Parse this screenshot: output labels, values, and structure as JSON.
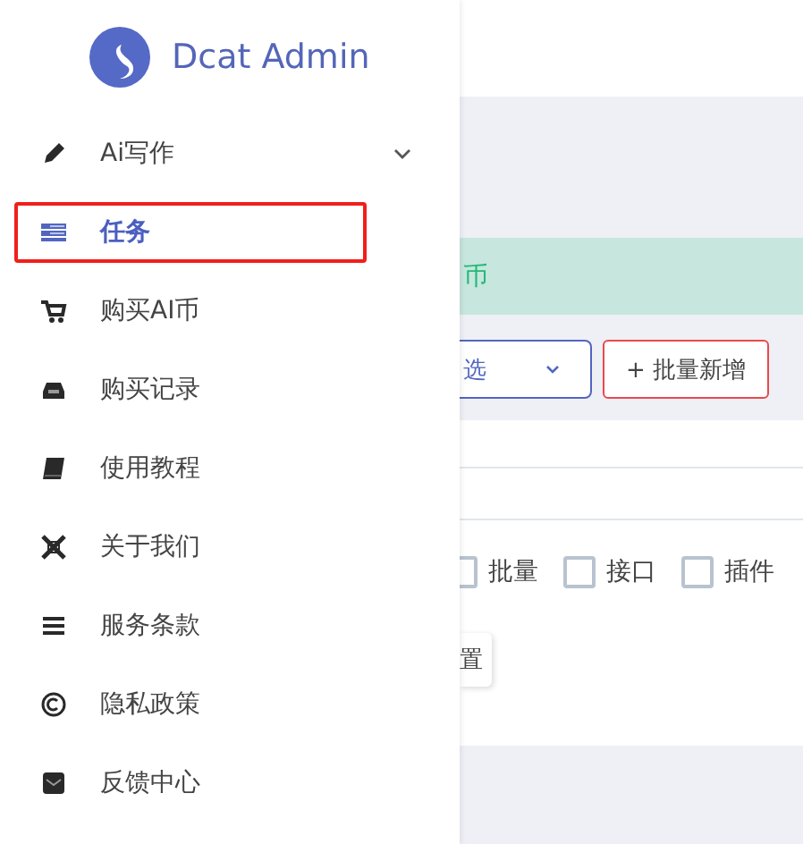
{
  "brand": {
    "title": "Dcat Admin"
  },
  "sidebar": {
    "items": [
      {
        "kind": "group",
        "label": "Ai写作",
        "selected": false,
        "highlighted": false
      },
      {
        "kind": "link",
        "label": "任务",
        "selected": true,
        "highlighted": true
      },
      {
        "kind": "link",
        "label": "购买AI币",
        "selected": false,
        "highlighted": false
      },
      {
        "kind": "link",
        "label": "购买记录",
        "selected": false,
        "highlighted": false
      },
      {
        "kind": "link",
        "label": "使用教程",
        "selected": false,
        "highlighted": false
      },
      {
        "kind": "link",
        "label": "关于我们",
        "selected": false,
        "highlighted": false
      },
      {
        "kind": "link",
        "label": "服务条款",
        "selected": false,
        "highlighted": false
      },
      {
        "kind": "link",
        "label": "隐私政策",
        "selected": false,
        "highlighted": false
      },
      {
        "kind": "link",
        "label": "反馈中心",
        "selected": false,
        "highlighted": false
      }
    ]
  },
  "content": {
    "alert": "币",
    "select": "选",
    "add_button": "+ 批量新增",
    "checkboxes": [
      {
        "label": "批量",
        "checked": false
      },
      {
        "label": "接口",
        "checked": false
      },
      {
        "label": "插件",
        "checked": false
      }
    ],
    "button": "置"
  }
}
